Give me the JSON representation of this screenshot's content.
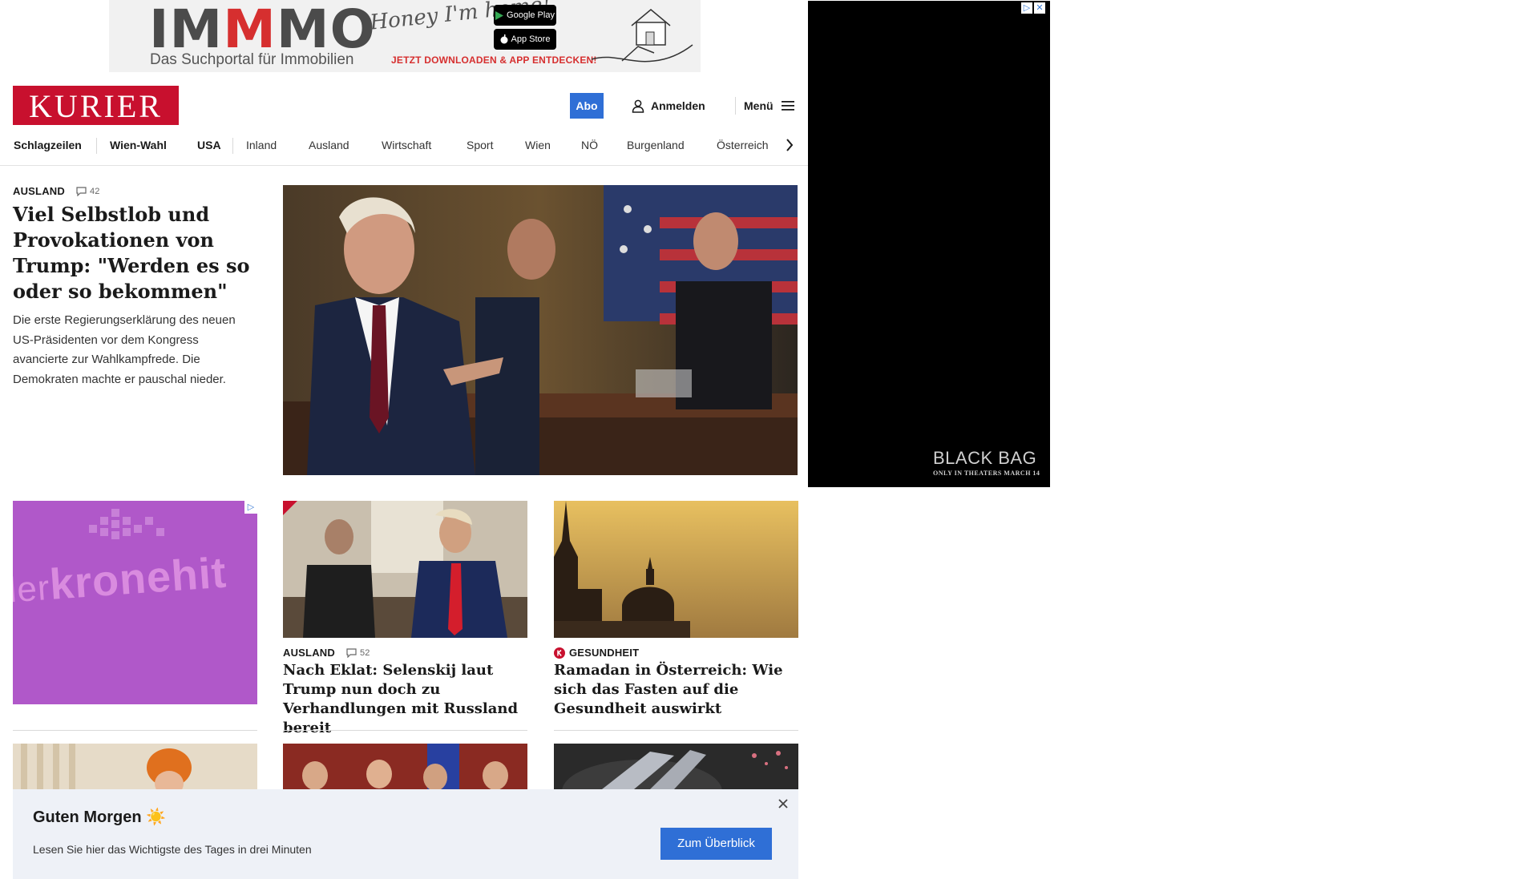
{
  "top_ad": {
    "brand_pre": "IM",
    "brand_m": "M",
    "brand_post": "MO",
    "tagline": "Das Suchportal für Immobilien",
    "slogan": "Honey I'm home!",
    "google_play": "Google Play",
    "app_store": "App Store",
    "cta": "JETZT DOWNLOADEN & APP ENTDECKEN!"
  },
  "side_ad": {
    "title": "BLACK BAG",
    "subtitle": "ONLY IN THEATERS MARCH 14"
  },
  "header": {
    "logo": "KURIER",
    "abo": "Abo",
    "login": "Anmelden",
    "menu": "Menü"
  },
  "nav": {
    "items": [
      "Schlagzeilen",
      "Wien-Wahl",
      "USA",
      "Inland",
      "Ausland",
      "Wirtschaft",
      "Sport",
      "Wien",
      "NÖ",
      "Burgenland",
      "Österreich"
    ]
  },
  "lead": {
    "kicker": "AUSLAND",
    "comments": "42",
    "title": "Viel Selbstlob und Provokationen von Trump: \"Werden es so oder so bekommen\"",
    "teaser": "Die erste Regierungserklärung des neuen US-Präsidenten vor dem Kongress avancierte zur Wahlkampfrede. Die Demokraten machte er pauschal nieder."
  },
  "ad_kronehit": {
    "pre": "ler",
    "text": "kronehit"
  },
  "cards": [
    {
      "kicker": "AUSLAND",
      "comments": "52",
      "title": "Nach Eklat: Selenskij laut Trump nun doch zu Verhandlungen mit Russland bereit"
    },
    {
      "kicker": "GESUNDHEIT",
      "title": "Ramadan in Österreich: Wie sich das Fasten auf die Gesundheit auswirkt"
    }
  ],
  "notice": {
    "title": "Guten Morgen ☀️",
    "text": "Lesen Sie hier das Wichtigste des Tages in drei Minuten",
    "button": "Zum Überblick"
  },
  "colors": {
    "brand_red": "#c8102e",
    "accent_blue": "#2f6fd6",
    "notice_bg": "#eef1f7",
    "kronehit_purple": "#b058c9"
  }
}
